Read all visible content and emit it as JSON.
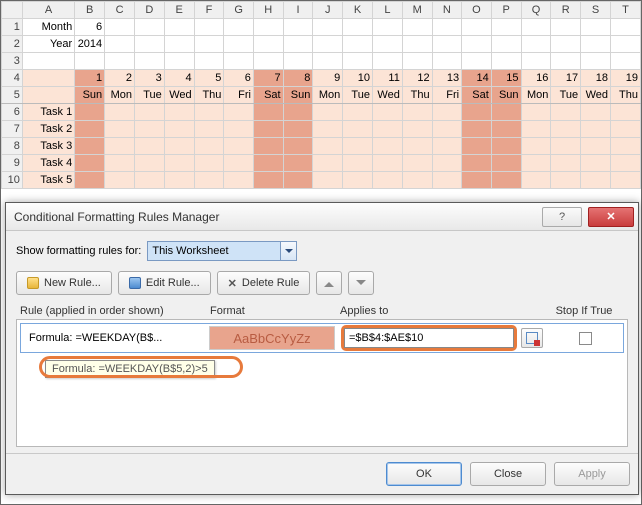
{
  "columns": [
    "A",
    "B",
    "C",
    "D",
    "E",
    "F",
    "G",
    "H",
    "I",
    "J",
    "K",
    "L",
    "M",
    "N",
    "O",
    "P",
    "Q",
    "R",
    "S",
    "T"
  ],
  "rows": {
    "1": {
      "A": "Month",
      "B": "6"
    },
    "2": {
      "A": "Year",
      "B": "2014"
    }
  },
  "dayNumbers": [
    "1",
    "2",
    "3",
    "4",
    "5",
    "6",
    "7",
    "8",
    "9",
    "10",
    "11",
    "12",
    "13",
    "14",
    "15",
    "16",
    "17",
    "18",
    "19"
  ],
  "dayNames": [
    "Sun",
    "Mon",
    "Tue",
    "Wed",
    "Thu",
    "Fri",
    "Sat",
    "Sun",
    "Mon",
    "Tue",
    "Wed",
    "Thu",
    "Fri",
    "Sat",
    "Sun",
    "Mon",
    "Tue",
    "Wed",
    "Thu"
  ],
  "weekendIdx": [
    0,
    6,
    7,
    13,
    14
  ],
  "tasks": [
    "Task 1",
    "Task 2",
    "Task 3",
    "Task 4",
    "Task 5"
  ],
  "dialog": {
    "title": "Conditional Formatting Rules Manager",
    "showFor_label": "Show formatting rules for:",
    "showFor_value": "This Worksheet",
    "btn_new": "New Rule...",
    "btn_edit": "Edit Rule...",
    "btn_delete": "Delete Rule",
    "hdr_rule": "Rule (applied in order shown)",
    "hdr_format": "Format",
    "hdr_applies": "Applies to",
    "hdr_stop": "Stop If True",
    "rule_text": "Formula: =WEEKDAY(B$...",
    "rule_preview": "AaBbCcYyZz",
    "rule_range": "=$B$4:$AE$10",
    "tooltip": "Formula: =WEEKDAY(B$5,2)>5",
    "btn_ok": "OK",
    "btn_close": "Close",
    "btn_apply": "Apply",
    "help_tip": "?",
    "close_tip": "✕"
  }
}
